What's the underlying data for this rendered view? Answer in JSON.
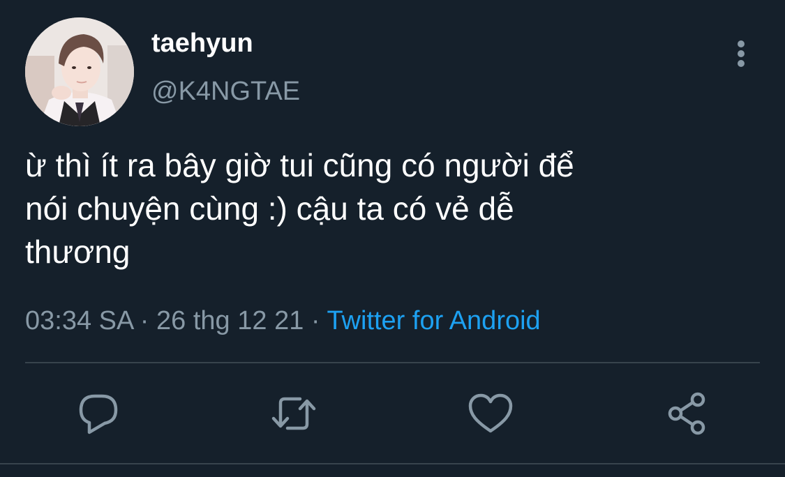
{
  "tweet": {
    "display_name": "taehyun",
    "handle": "@K4NGTAE",
    "text": "ừ thì ít ra bây giờ tui cũng có người để\nnói chuyện cùng :) cậu ta có vẻ dễ\nthương",
    "time": "03:34 SA",
    "separator": " · ",
    "date": "26 thg 12 21",
    "source": "Twitter for Android"
  },
  "icons": {
    "more": "more-vertical-icon",
    "reply": "reply-icon",
    "retweet": "retweet-icon",
    "like": "heart-icon",
    "share": "share-icon"
  },
  "colors": {
    "background": "#15202b",
    "primary_text": "#ffffff",
    "secondary_text": "#8899a6",
    "link": "#1da1f2",
    "divider": "#38444d"
  }
}
